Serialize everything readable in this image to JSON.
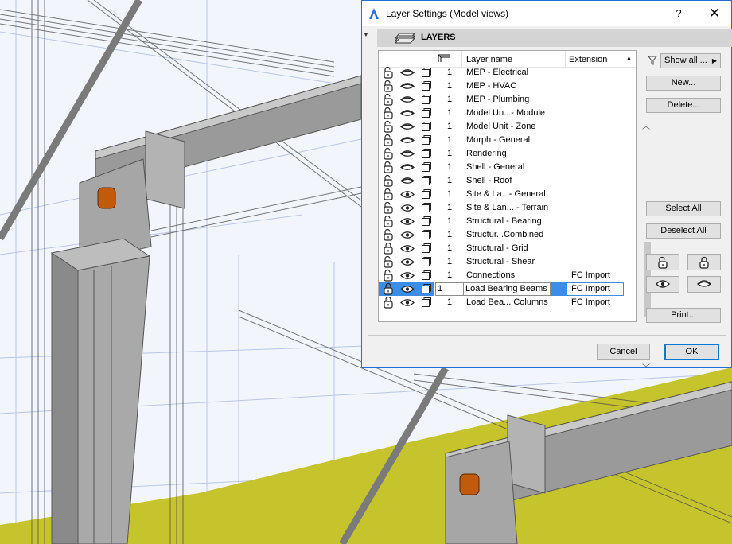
{
  "dialog": {
    "title": "Layer Settings (Model views)",
    "help_label": "?",
    "close_label": "✕",
    "section_title": "LAYERS"
  },
  "list": {
    "columns": {
      "name": "Layer name",
      "extension": "Extension"
    },
    "rows": [
      {
        "lock": "unlocked",
        "eye": "hidden",
        "num": "1",
        "name": "MEP - Electrical",
        "ext": ""
      },
      {
        "lock": "unlocked",
        "eye": "hidden",
        "num": "1",
        "name": "MEP - HVAC",
        "ext": ""
      },
      {
        "lock": "unlocked",
        "eye": "hidden",
        "num": "1",
        "name": "MEP - Plumbing",
        "ext": ""
      },
      {
        "lock": "unlocked",
        "eye": "hidden",
        "num": "1",
        "name": "Model Un...- Module",
        "ext": ""
      },
      {
        "lock": "unlocked",
        "eye": "hidden",
        "num": "1",
        "name": "Model Unit - Zone",
        "ext": ""
      },
      {
        "lock": "unlocked",
        "eye": "hidden",
        "num": "1",
        "name": "Morph - General",
        "ext": ""
      },
      {
        "lock": "unlocked",
        "eye": "hidden",
        "num": "1",
        "name": "Rendering",
        "ext": ""
      },
      {
        "lock": "unlocked",
        "eye": "hidden",
        "num": "1",
        "name": "Shell - General",
        "ext": ""
      },
      {
        "lock": "unlocked",
        "eye": "hidden",
        "num": "1",
        "name": "Shell - Roof",
        "ext": ""
      },
      {
        "lock": "unlocked",
        "eye": "visible",
        "num": "1",
        "name": "Site & La...- General",
        "ext": ""
      },
      {
        "lock": "unlocked",
        "eye": "visible",
        "num": "1",
        "name": "Site & Lan... - Terrain",
        "ext": ""
      },
      {
        "lock": "unlocked",
        "eye": "visible",
        "num": "1",
        "name": "Structural - Bearing",
        "ext": ""
      },
      {
        "lock": "unlocked",
        "eye": "visible",
        "num": "1",
        "name": "Structur...Combined",
        "ext": ""
      },
      {
        "lock": "locked",
        "eye": "visible",
        "num": "1",
        "name": "Structural - Grid",
        "ext": ""
      },
      {
        "lock": "unlocked",
        "eye": "visible",
        "num": "1",
        "name": "Structural - Shear",
        "ext": ""
      },
      {
        "lock": "unlocked",
        "eye": "visible",
        "num": "1",
        "name": "Connections",
        "ext": "IFC Import"
      },
      {
        "lock": "locked",
        "eye": "visible",
        "num": "1",
        "name": "Load Bearing Beams",
        "ext": "IFC Import",
        "selected": true
      },
      {
        "lock": "locked",
        "eye": "visible",
        "num": "1",
        "name": "Load Bea... Columns",
        "ext": "IFC Import"
      }
    ]
  },
  "side": {
    "show_all": "Show all ...",
    "new": "New...",
    "delete": "Delete...",
    "select_all": "Select All",
    "deselect_all": "Deselect All",
    "print": "Print..."
  },
  "footer": {
    "cancel": "Cancel",
    "ok": "OK"
  },
  "colors": {
    "selection": "#3b8ee8",
    "dialog_border": "#1e6fd9",
    "floor_yellow": "#c6c42c",
    "steel_grey": "#8f8f8f",
    "bolt_orange": "#c25a0c"
  }
}
